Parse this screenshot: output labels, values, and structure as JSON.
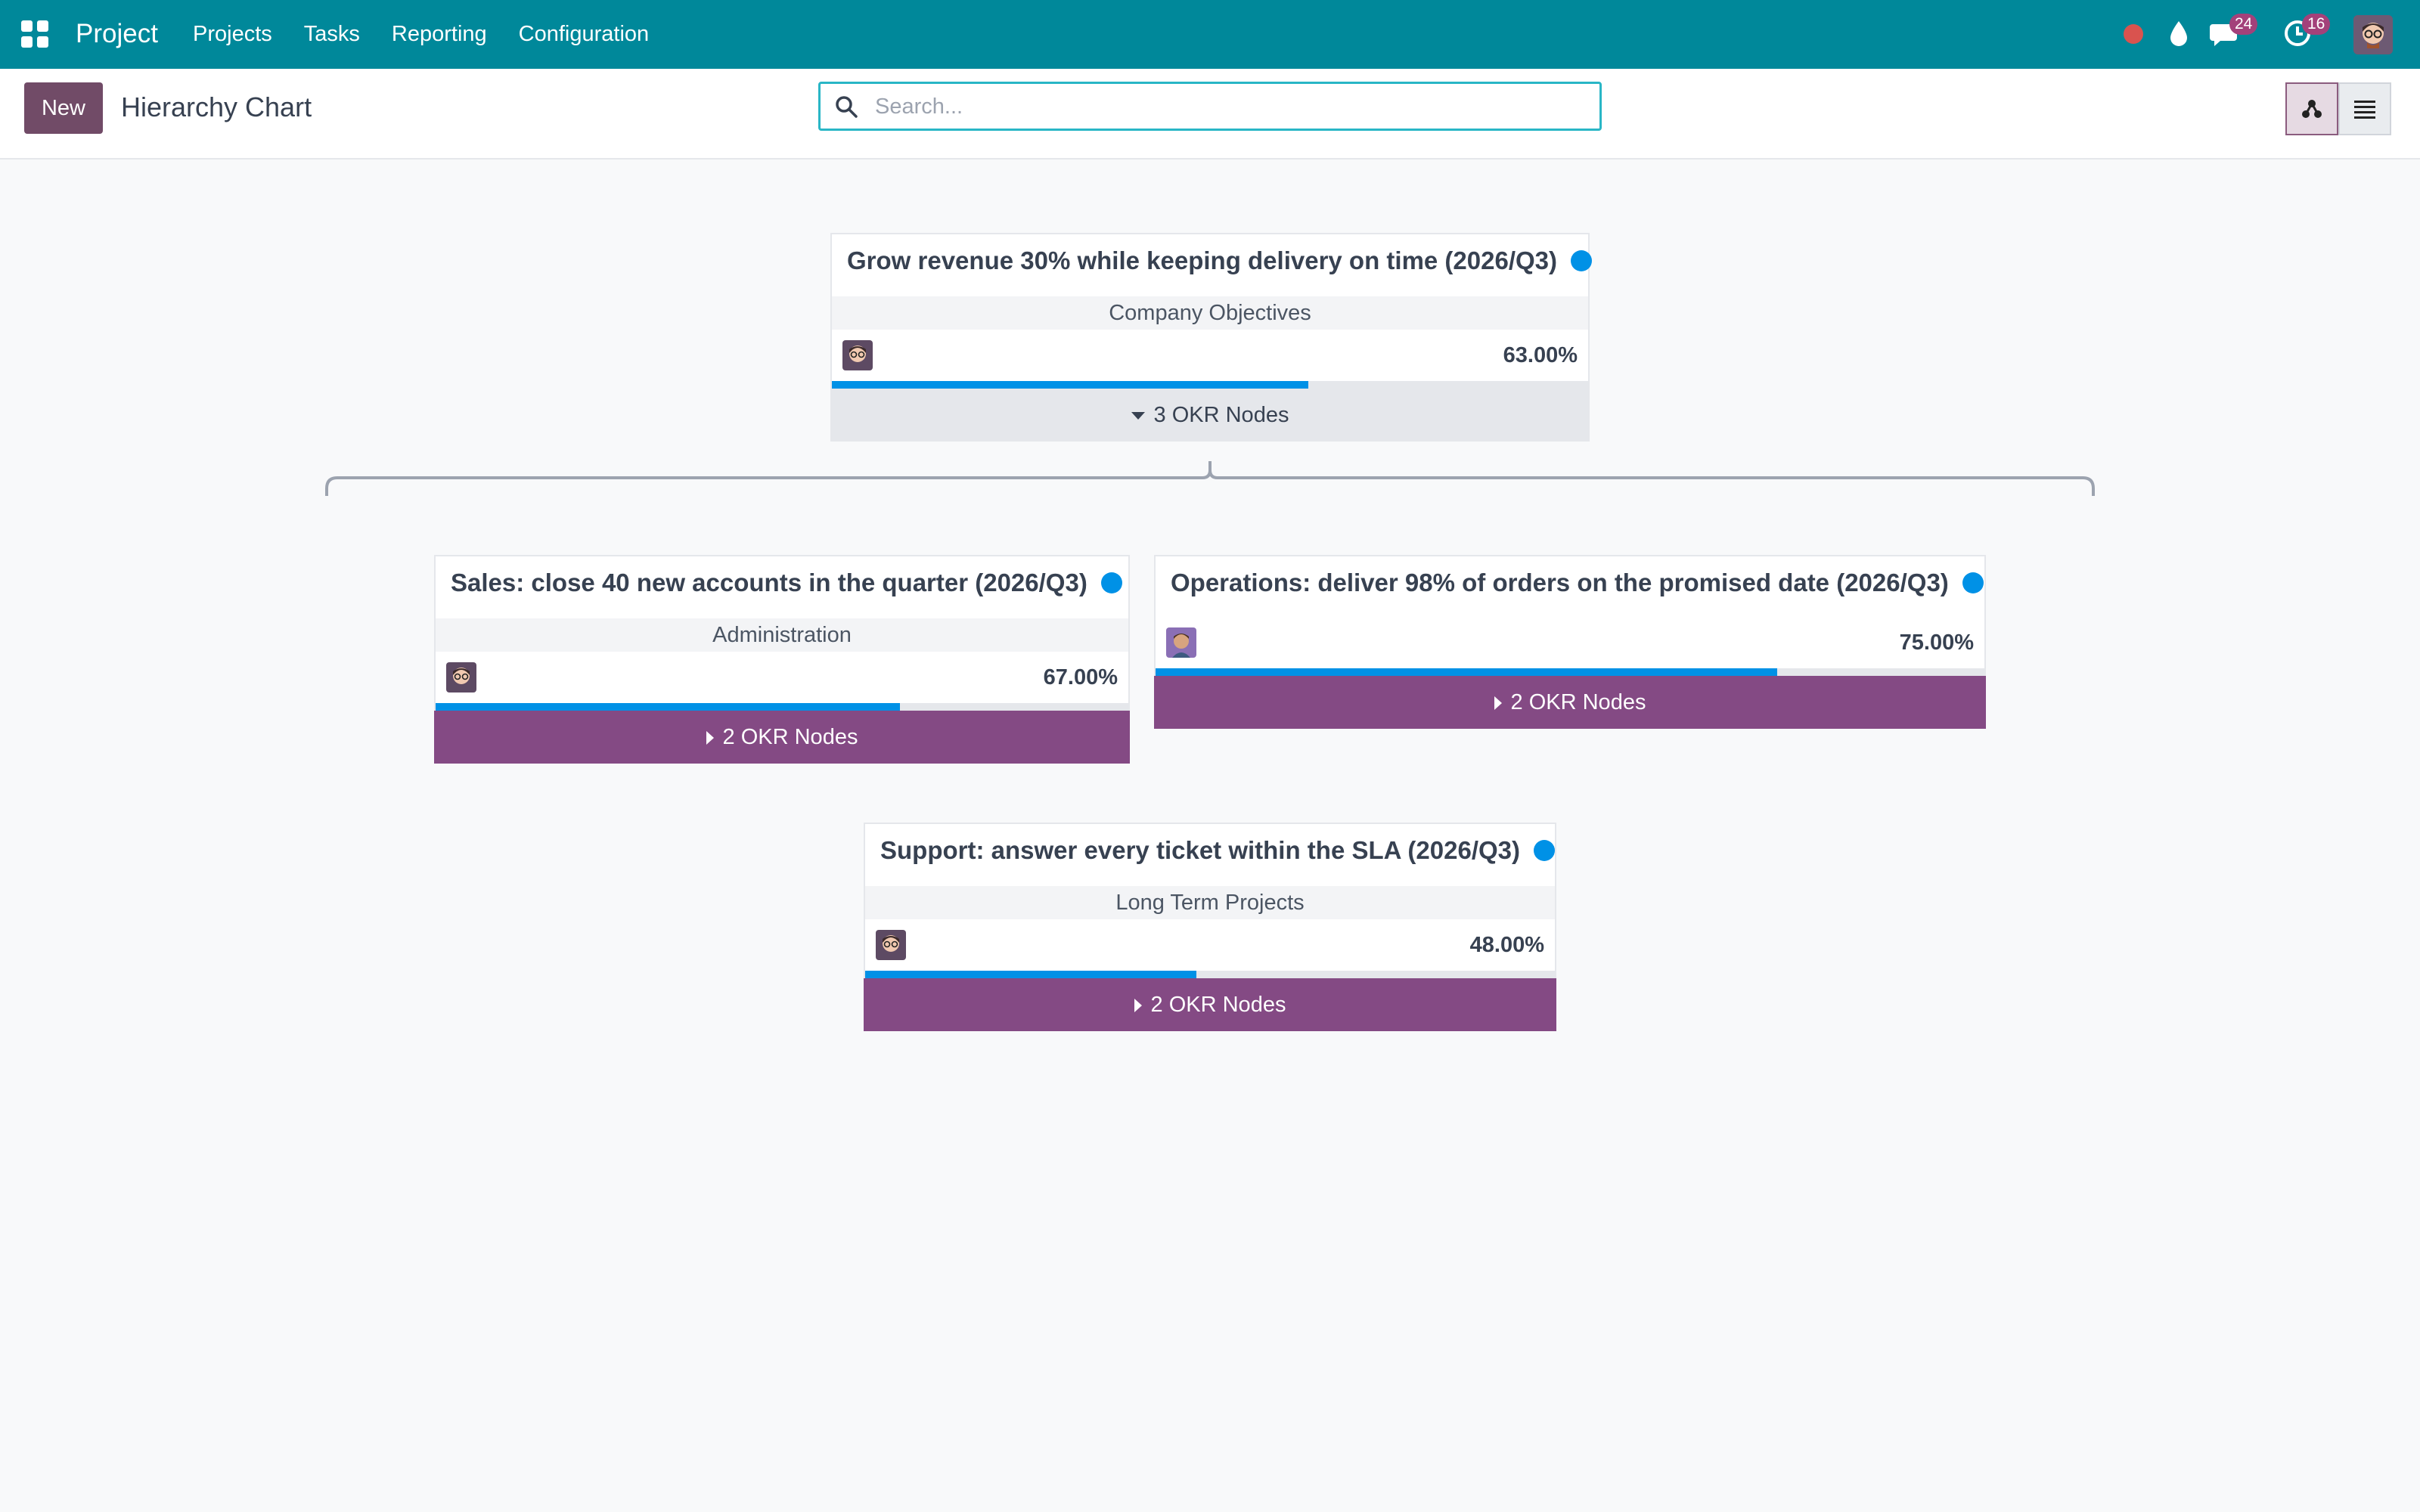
{
  "navbar": {
    "brand": "Project",
    "menu": [
      "Projects",
      "Tasks",
      "Reporting",
      "Configuration"
    ],
    "messages_count": "24",
    "activities_count": "16"
  },
  "control_panel": {
    "new_label": "New",
    "title": "Hierarchy Chart",
    "search_placeholder": "Search..."
  },
  "nodes": [
    {
      "title": "Grow revenue 30% while keeping delivery on time (2026/Q3)",
      "subtitle": "Company Objectives",
      "progress_text": "63.00%",
      "progress": 63,
      "expand_label": "3 OKR Nodes",
      "expanded": true
    },
    {
      "title": "Sales: close 40 new accounts in the quarter (2026/Q3)",
      "subtitle": "Administration",
      "progress_text": "67.00%",
      "progress": 67,
      "expand_label": "2 OKR Nodes",
      "expanded": false
    },
    {
      "title": "Operations: deliver 98% of orders on the promised date (2026/Q3)",
      "subtitle": "",
      "progress_text": "75.00%",
      "progress": 75,
      "expand_label": "2 OKR Nodes",
      "expanded": false
    },
    {
      "title": "Support: answer every ticket within the SLA (2026/Q3)",
      "subtitle": "Long Term Projects",
      "progress_text": "48.00%",
      "progress": 48,
      "expand_label": "2 OKR Nodes",
      "expanded": false
    }
  ],
  "colors": {
    "navbar": "#00889a",
    "primary": "#714b67",
    "expand_button": "#844a84",
    "progress": "#0091e6",
    "status_dot": "#0091e6"
  },
  "icons": [
    "apps-grid-icon",
    "record-icon",
    "drop-icon",
    "chat-icon",
    "clock-icon",
    "search-icon",
    "hierarchy-view-icon",
    "list-view-icon"
  ]
}
